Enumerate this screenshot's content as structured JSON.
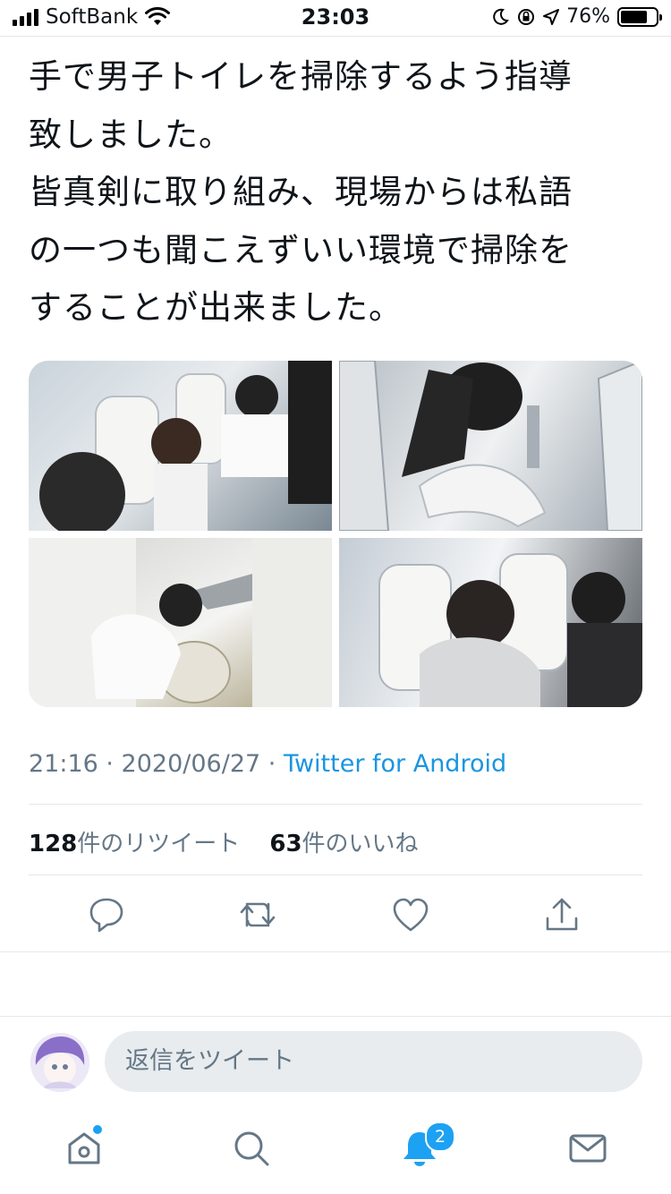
{
  "status_bar": {
    "carrier": "SoftBank",
    "time": "23:03",
    "battery": "76%",
    "battery_level": 0.76
  },
  "tweet": {
    "text_lines": [
      "手で男子トイレを掃除するよう指導",
      "致しました。",
      "皆真剣に取り組み、現場からは私語",
      "の一つも聞こえずいい環境で掃除を",
      "することが出来ました。"
    ],
    "timestamp": "21:16 · 2020/06/27 · ",
    "source": "Twitter for Android",
    "retweets_count": "128",
    "retweets_label": "件のリツイート",
    "likes_count": "63",
    "likes_label": "件のいいね"
  },
  "media": {
    "photos": [
      "photo-1",
      "photo-2",
      "photo-3",
      "photo-4"
    ]
  },
  "actions": [
    "reply-icon",
    "retweet-icon",
    "like-icon",
    "share-icon"
  ],
  "reply": {
    "placeholder": "返信をツイート"
  },
  "tabbar": {
    "tabs": [
      "home-icon",
      "search-icon",
      "notifications-icon",
      "messages-icon"
    ],
    "notifications_badge": "2"
  },
  "colors": {
    "accent": "#1da1f2",
    "source_link": "#1b95e0",
    "muted": "#657786"
  }
}
